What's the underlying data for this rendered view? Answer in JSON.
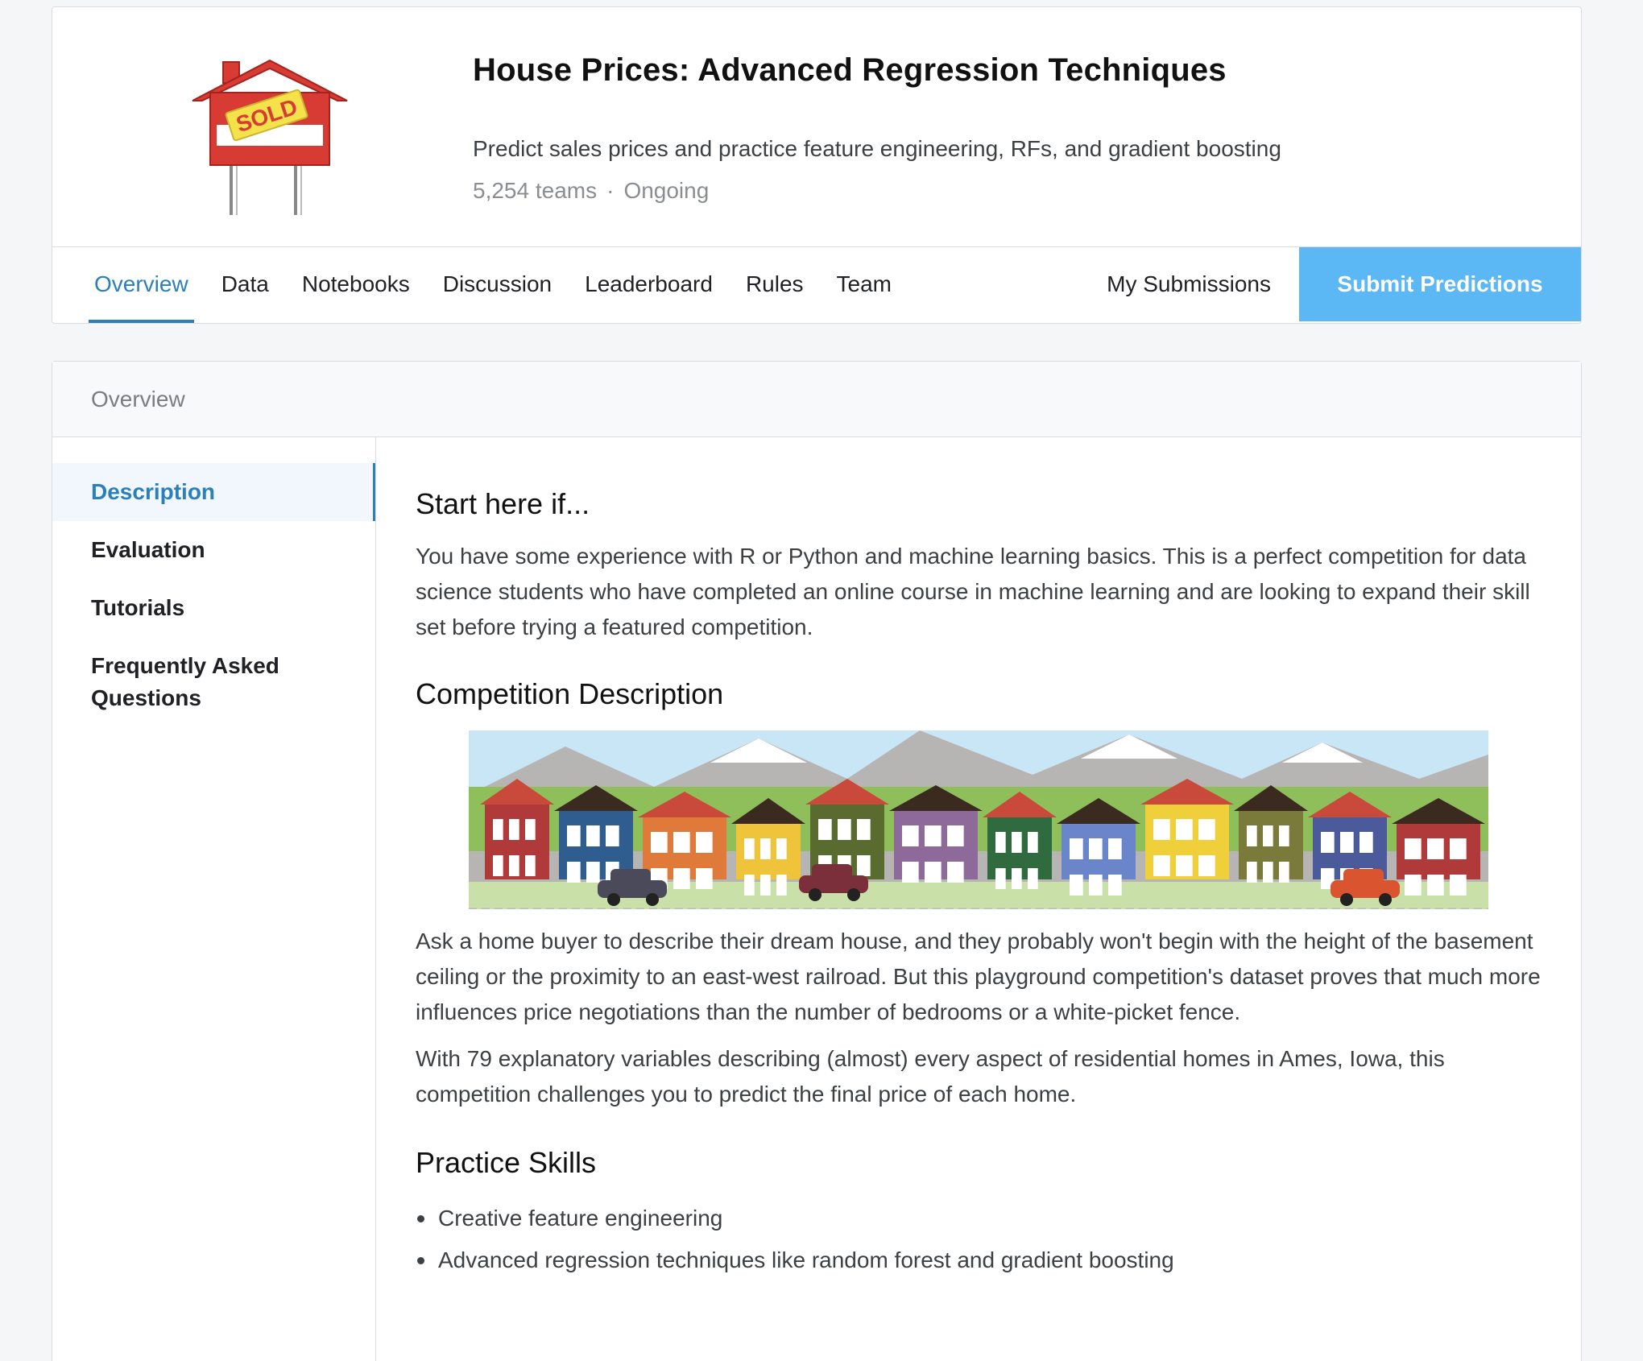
{
  "competition": {
    "title": "House Prices: Advanced Regression Techniques",
    "subtitle": "Predict sales prices and practice feature engineering, RFs, and gradient boosting",
    "teams": "5,254 teams",
    "separator": "·",
    "status": "Ongoing",
    "logo_sign_text": "SOLD"
  },
  "nav": {
    "tabs": [
      "Overview",
      "Data",
      "Notebooks",
      "Discussion",
      "Leaderboard",
      "Rules",
      "Team"
    ],
    "active_tab": "Overview",
    "my_submissions": "My Submissions",
    "submit": "Submit Predictions"
  },
  "content": {
    "section_title": "Overview",
    "sidenav": [
      "Description",
      "Evaluation",
      "Tutorials",
      "Frequently Asked Questions"
    ],
    "active_side": "Description",
    "start_heading": "Start here if...",
    "start_text": "You have some experience with R or Python and machine learning basics. This is a perfect competition for data science students who have completed an online course in machine learning and are looking to expand their skill set before trying a featured competition.",
    "comp_heading": "Competition Description",
    "comp_text_1": "Ask a home buyer to describe their dream house, and they probably won't begin with the height of the basement ceiling or the proximity to an east-west railroad. But this playground competition's dataset proves that much more influences price negotiations than the number of bedrooms or a white-picket fence.",
    "comp_text_2": "With 79 explanatory variables describing (almost) every aspect of residential homes in Ames, Iowa, this competition challenges you to predict the final price of each home.",
    "skills_heading": "Practice Skills",
    "skills": [
      "Creative feature engineering",
      "Advanced regression techniques like random forest and gradient boosting"
    ]
  },
  "colors": {
    "accent": "#2b7fba",
    "submit_bg": "#5cb8f5",
    "sign_red": "#d83a34",
    "sign_yellow": "#f5e14a"
  }
}
